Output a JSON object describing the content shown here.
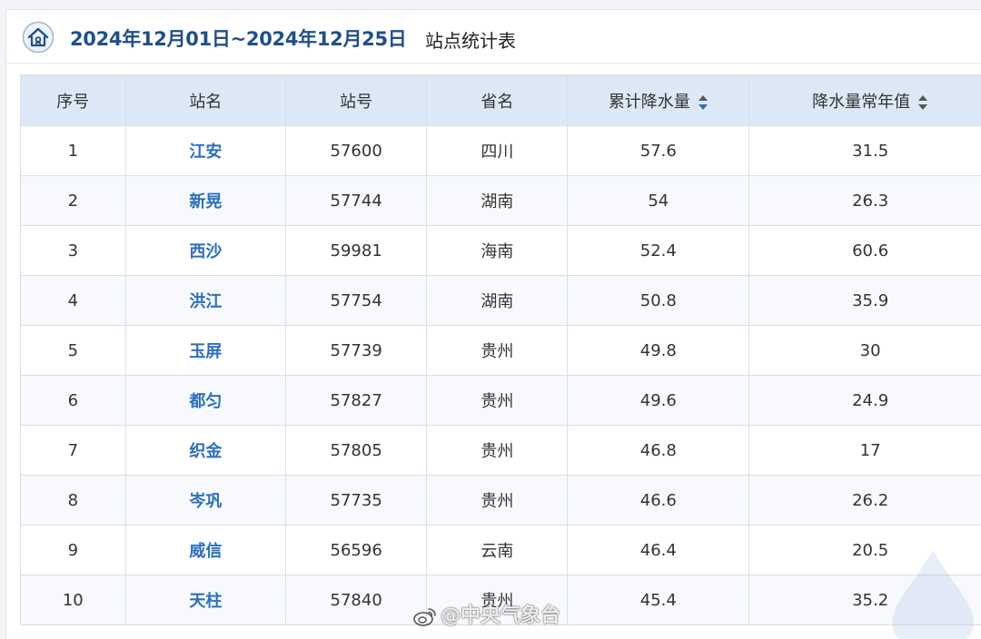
{
  "header": {
    "date_range": "2024年12月01日~2024年12月25日",
    "title": "站点统计表",
    "icon": "home-icon"
  },
  "table": {
    "columns": [
      "序号",
      "站名",
      "站号",
      "省名",
      "累计降水量",
      "降水量常年值"
    ],
    "rows": [
      {
        "seq": "1",
        "name": "江安",
        "id": "57600",
        "province": "四川",
        "total": "57.6",
        "normal": "31.5"
      },
      {
        "seq": "2",
        "name": "新晃",
        "id": "57744",
        "province": "湖南",
        "total": "54",
        "normal": "26.3"
      },
      {
        "seq": "3",
        "name": "西沙",
        "id": "59981",
        "province": "海南",
        "total": "52.4",
        "normal": "60.6"
      },
      {
        "seq": "4",
        "name": "洪江",
        "id": "57754",
        "province": "湖南",
        "total": "50.8",
        "normal": "35.9"
      },
      {
        "seq": "5",
        "name": "玉屏",
        "id": "57739",
        "province": "贵州",
        "total": "49.8",
        "normal": "30"
      },
      {
        "seq": "6",
        "name": "都匀",
        "id": "57827",
        "province": "贵州",
        "total": "49.6",
        "normal": "24.9"
      },
      {
        "seq": "7",
        "name": "织金",
        "id": "57805",
        "province": "贵州",
        "total": "46.8",
        "normal": "17"
      },
      {
        "seq": "8",
        "name": "岑巩",
        "id": "57735",
        "province": "贵州",
        "total": "46.6",
        "normal": "26.2"
      },
      {
        "seq": "9",
        "name": "威信",
        "id": "56596",
        "province": "云南",
        "total": "46.4",
        "normal": "20.5"
      },
      {
        "seq": "10",
        "name": "天柱",
        "id": "57840",
        "province": "贵州",
        "total": "45.4",
        "normal": "35.2"
      }
    ]
  },
  "watermark": {
    "text": "@中央气象台",
    "icon": "weibo-icon"
  },
  "colors": {
    "title_blue": "#1d4f8c",
    "link_blue": "#2c6fbf",
    "header_bg": "#dce8f5",
    "sort_active": "#2c6fbf",
    "sort_inactive": "#555555"
  }
}
